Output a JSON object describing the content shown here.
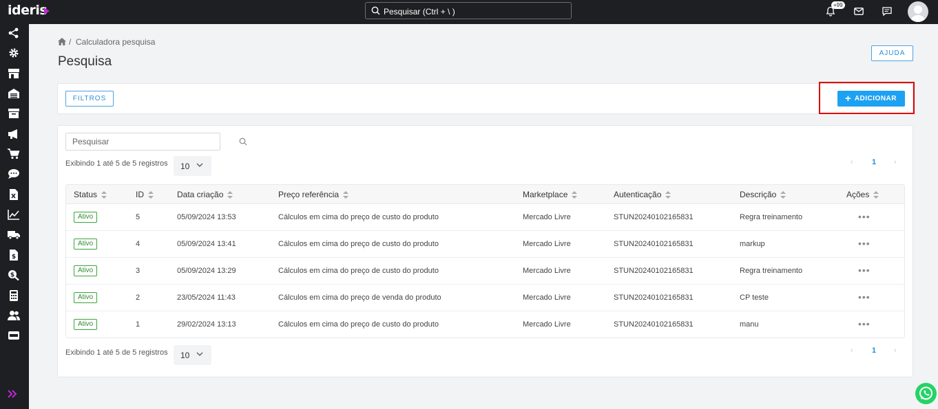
{
  "app": {
    "logo": "ideris"
  },
  "topbar": {
    "search_placeholder": "Pesquisar (Ctrl + \\ )",
    "notif_badge": "+99",
    "icons": [
      "bell-icon",
      "mail-icon",
      "chat-icon",
      "avatar"
    ]
  },
  "sidebar": {
    "icons": [
      "share-icon",
      "gear-icon",
      "store-icon",
      "warehouse-icon",
      "archive-icon",
      "megaphone-icon",
      "cart-icon",
      "chat-bubble-icon",
      "excel-file-icon",
      "chart-line-icon",
      "truck-icon",
      "invoice-icon",
      "dollar-search-icon",
      "calculator-icon",
      "users-icon",
      "server-icon",
      "expand-icon"
    ]
  },
  "breadcrumb": {
    "current": "Calculadora pesquisa",
    "separator": "/"
  },
  "page": {
    "title": "Pesquisa"
  },
  "buttons": {
    "ajuda": "AJUDA",
    "filtros": "FILTROS",
    "adicionar": "ADICIONAR"
  },
  "table_controls": {
    "search_placeholder": "Pesquisar",
    "info_text": "Exibindo 1 até 5 de 5 registros",
    "page_size": "10",
    "current_page": "1"
  },
  "table": {
    "columns": [
      "Status",
      "ID",
      "Data criação",
      "Preço referência",
      "Marketplace",
      "Autenticação",
      "Descrição",
      "Ações"
    ],
    "rows": [
      {
        "status": "Ativo",
        "id": "5",
        "date": "05/09/2024 13:53",
        "price_ref": "Cálculos em cima do preço de custo do produto",
        "marketplace": "Mercado Livre",
        "auth": "STUN20240102165831",
        "desc": "Regra treinamento",
        "actions": "•••"
      },
      {
        "status": "Ativo",
        "id": "4",
        "date": "05/09/2024 13:41",
        "price_ref": "Cálculos em cima do preço de custo do produto",
        "marketplace": "Mercado Livre",
        "auth": "STUN20240102165831",
        "desc": "markup",
        "actions": "•••"
      },
      {
        "status": "Ativo",
        "id": "3",
        "date": "05/09/2024 13:29",
        "price_ref": "Cálculos em cima do preço de custo do produto",
        "marketplace": "Mercado Livre",
        "auth": "STUN20240102165831",
        "desc": "Regra treinamento",
        "actions": "•••"
      },
      {
        "status": "Ativo",
        "id": "2",
        "date": "23/05/2024 11:43",
        "price_ref": "Cálculos em cima do preço de venda do produto",
        "marketplace": "Mercado Livre",
        "auth": "STUN20240102165831",
        "desc": "CP teste",
        "actions": "•••"
      },
      {
        "status": "Ativo",
        "id": "1",
        "date": "29/02/2024 13:13",
        "price_ref": "Cálculos em cima do preço de custo do produto",
        "marketplace": "Mercado Livre",
        "auth": "STUN20240102165831",
        "desc": "manu",
        "actions": "•••"
      }
    ]
  },
  "colors": {
    "accent": "#1da1f2",
    "active": "#2e8b2e",
    "highlight": "#e00000",
    "sidebar": "#1d1f22",
    "whatsapp": "#25d366"
  }
}
